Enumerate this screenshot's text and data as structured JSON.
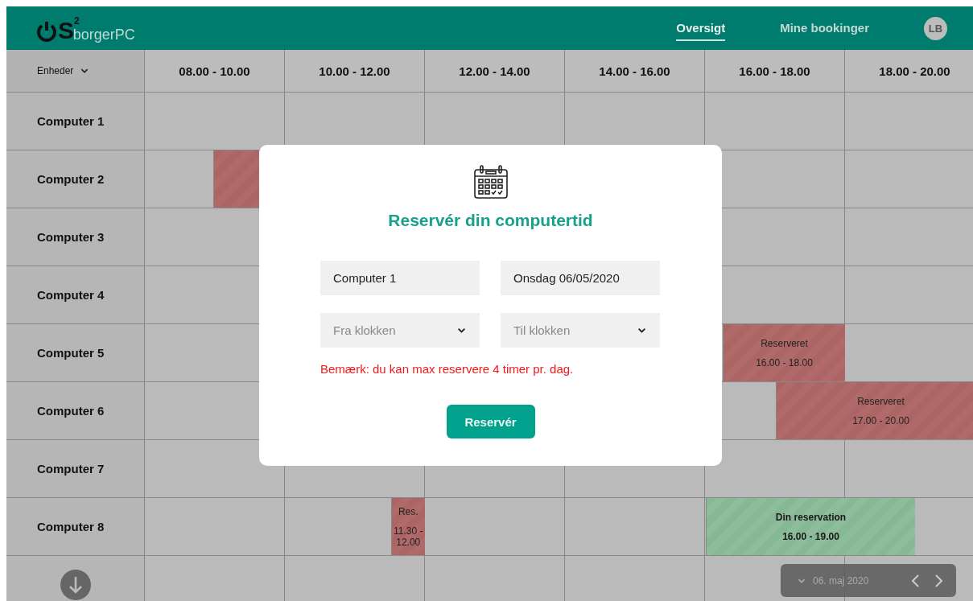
{
  "header": {
    "logo": {
      "letter": "S",
      "superscript": "2",
      "name": "borgerPC"
    },
    "nav": [
      {
        "label": "Oversigt",
        "selected": true
      },
      {
        "label": "Mine bookinger",
        "selected": false
      }
    ],
    "avatar": "LB"
  },
  "schedule": {
    "unit_filter": "Enheder",
    "slots": [
      "08.00 - 10.00",
      "10.00 - 12.00",
      "12.00 - 14.00",
      "14.00 - 16.00",
      "16.00 - 18.00",
      "18.00 - 20.00"
    ],
    "rows": [
      {
        "name": "Computer 1",
        "bookings": []
      },
      {
        "name": "Computer 2",
        "bookings": [
          {
            "kind": "covered"
          }
        ]
      },
      {
        "name": "Computer 3",
        "bookings": []
      },
      {
        "name": "Computer 4",
        "bookings": []
      },
      {
        "name": "Computer 5",
        "bookings": [
          {
            "kind": "reserved",
            "label": "Reserveret",
            "time": "16.00 - 18.00"
          }
        ]
      },
      {
        "name": "Computer 6",
        "bookings": [
          {
            "kind": "reserved",
            "label": "Reserveret",
            "time": "17.00 - 20.00"
          }
        ]
      },
      {
        "name": "Computer 7",
        "bookings": []
      },
      {
        "name": "Computer 8",
        "bookings": [
          {
            "kind": "reserved",
            "label": "Res.",
            "time": "11.30 - 12.00"
          },
          {
            "kind": "own",
            "label": "Din reservation",
            "time": "16.00 - 19.00"
          }
        ]
      },
      {
        "kind": "footer",
        "bookings": []
      }
    ]
  },
  "date_picker": {
    "date": "06. maj 2020"
  },
  "modal": {
    "title": "Reservér din computertid",
    "fields": [
      {
        "kind": "value",
        "value": "Computer 1"
      },
      {
        "kind": "value",
        "value": "Onsdag 06/05/2020"
      },
      {
        "kind": "select",
        "placeholder": "Fra klokken"
      },
      {
        "kind": "select",
        "placeholder": "Til klokken"
      }
    ],
    "notice": "Bemærk: du kan max reservere 4 timer pr. dag.",
    "button": "Reservér"
  }
}
